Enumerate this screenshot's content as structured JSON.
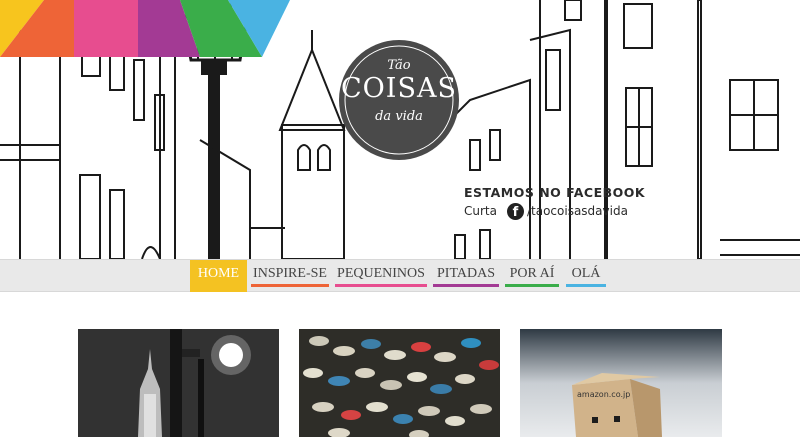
{
  "logo": {
    "line1": "Tão",
    "line2": "COISAS",
    "line3": "da vida"
  },
  "facebook": {
    "title": "ESTAMOS NO FACEBOOK",
    "curta": "Curta",
    "icon": "facebook-icon",
    "handle": "/taocoisasdavida"
  },
  "banner_colors": [
    "#f7c51e",
    "#ee6437",
    "#e74d8f",
    "#a33a94",
    "#3aad4a",
    "#4ab3e2"
  ],
  "nav": {
    "items": [
      {
        "label": "HOME",
        "color": "#f4c222",
        "active": true
      },
      {
        "label": "INSPIRE-SE",
        "color": "#ee6437",
        "active": false
      },
      {
        "label": "PEQUENINOS",
        "color": "#e74d8f",
        "active": false
      },
      {
        "label": "PITADAS",
        "color": "#a33a94",
        "active": false
      },
      {
        "label": "POR AÍ",
        "color": "#3aad4a",
        "active": false
      },
      {
        "label": "OLÁ",
        "color": "#4ab3e2",
        "active": false
      }
    ]
  },
  "thumbnails": {
    "third_label": "amazon.co.jp"
  }
}
